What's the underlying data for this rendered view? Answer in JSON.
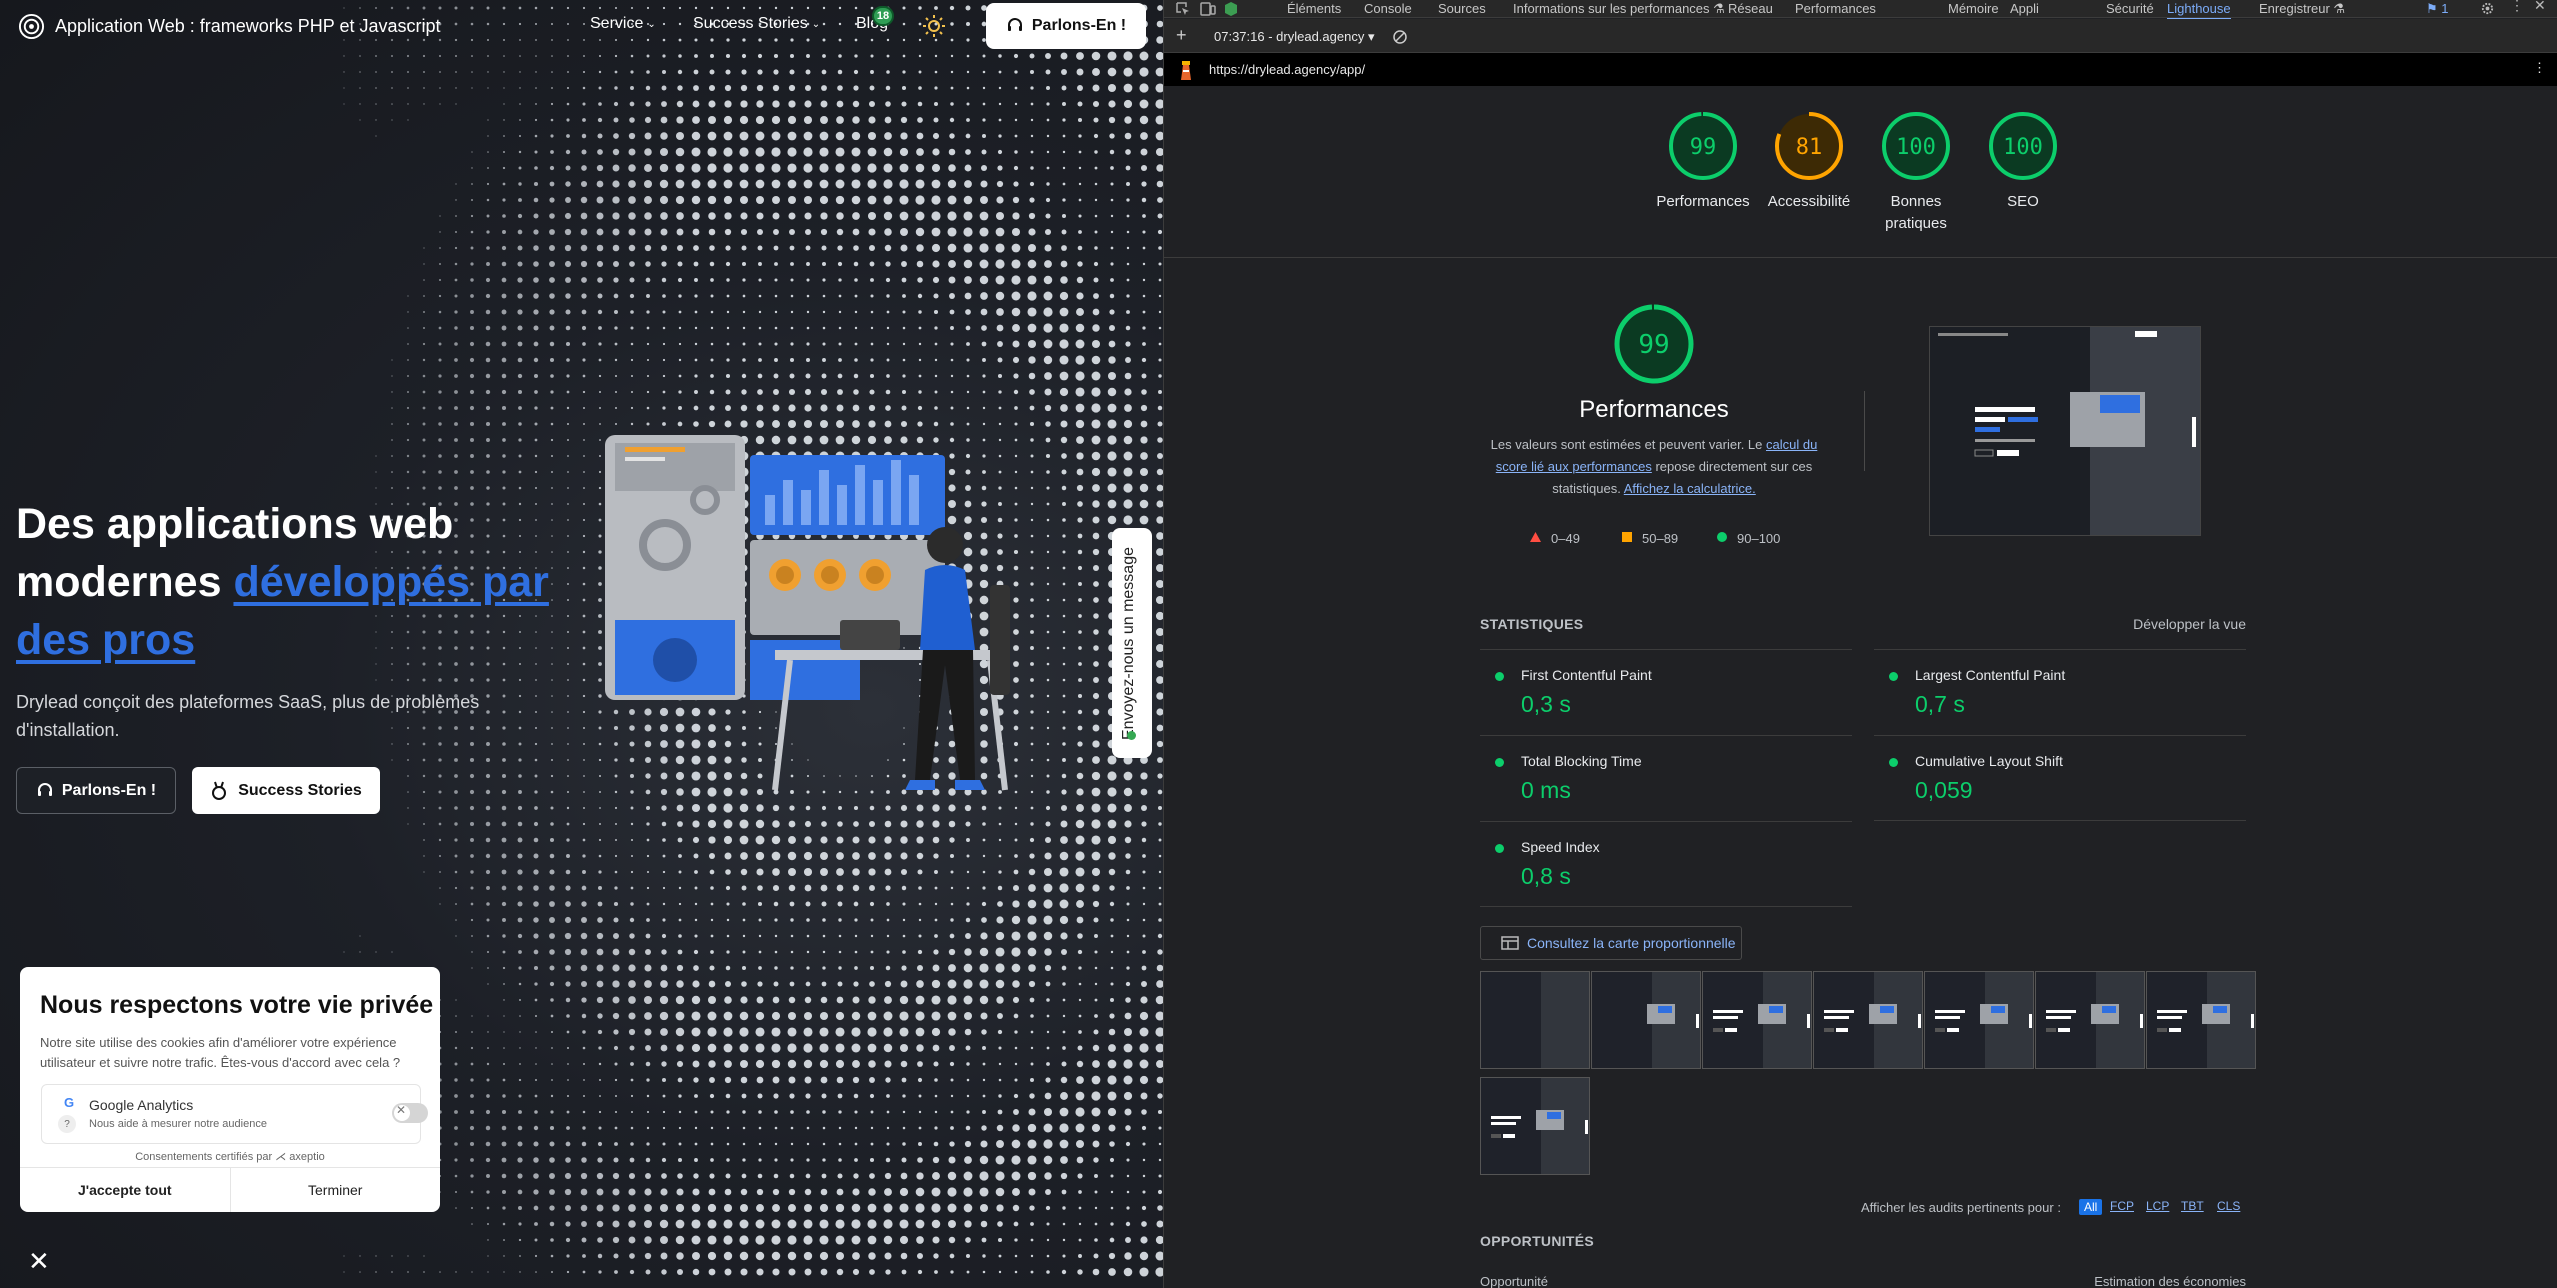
{
  "site": {
    "brand": "Application Web : frameworks PHP et Javascript",
    "nav": {
      "service": "Service",
      "success": "Success Stories",
      "blog": "Blog",
      "blog_badge": "18",
      "cta": "Parlons-En !"
    },
    "hero": {
      "title_part1": "Des applications web modernes ",
      "title_highlight": "développés par des pros",
      "subtitle": "Drylead conçoit des plateformes SaaS, plus de problèmes d'installation.",
      "btn_primary": "Parlons-En !",
      "btn_secondary": "Success Stories"
    },
    "side_tab": "Envoyez-nous un message",
    "cookie": {
      "title": "Nous respectons votre vie privée",
      "text": "Notre site utilise des cookies afin d'améliorer votre expérience utilisateur et suivre notre trafic. Êtes-vous d'accord avec cela ?",
      "service_name": "Google Analytics",
      "service_desc": "Nous aide à mesurer notre audience",
      "certified": "Consentements certifiés par ⋌ axeptio",
      "accept": "J'accepte tout",
      "finish": "Terminer"
    },
    "accent_color": "#2f6fe0"
  },
  "devtools": {
    "tabs": [
      "Éléments",
      "Console",
      "Sources",
      "Informations sur les performances ⚗",
      "Réseau",
      "Performances",
      "Mémoire",
      "Appli",
      "Sécurité",
      "Lighthouse",
      "Enregistreur ⚗"
    ],
    "active_tab": "Lighthouse",
    "issues_count": "1",
    "toolbar_report": "07:37:16 - drylead.agency",
    "url": "https://drylead.agency/app/",
    "gauges": [
      {
        "score": 99,
        "label": "Performances",
        "color": "#0cce6b"
      },
      {
        "score": 81,
        "label": "Accessibilité",
        "color": "#ffa400"
      },
      {
        "score": 100,
        "label": "Bonnes pratiques",
        "color": "#0cce6b"
      },
      {
        "score": 100,
        "label": "SEO",
        "color": "#0cce6b"
      }
    ],
    "perf": {
      "score": "99",
      "title": "Performances",
      "desc_1": "Les valeurs sont estimées et peuvent varier. Le ",
      "desc_link_1": "calcul du score lié aux performances",
      "desc_2": " repose directement sur ces statistiques. ",
      "desc_link_2": "Affichez la calculatrice."
    },
    "legend": {
      "fail": "0–49",
      "average": "50–89",
      "pass": "90–100"
    },
    "stats_title": "STATISTIQUES",
    "expand_view": "Développer la vue",
    "metrics": [
      {
        "name": "First Contentful Paint",
        "value": "0,3 s"
      },
      {
        "name": "Largest Contentful Paint",
        "value": "0,7 s"
      },
      {
        "name": "Total Blocking Time",
        "value": "0 ms"
      },
      {
        "name": "Cumulative Layout Shift",
        "value": "0,059"
      },
      {
        "name": "Speed Index",
        "value": "0,8 s"
      }
    ],
    "treemap_btn": "Consultez la carte proportionnelle",
    "audits_filter": "Afficher les audits pertinents pour :",
    "chips": [
      "All",
      "FCP",
      "LCP",
      "TBT",
      "CLS"
    ],
    "opportunities": "OPPORTUNITÉS",
    "col_opportunity": "Opportunité",
    "col_savings": "Estimation des économies"
  }
}
